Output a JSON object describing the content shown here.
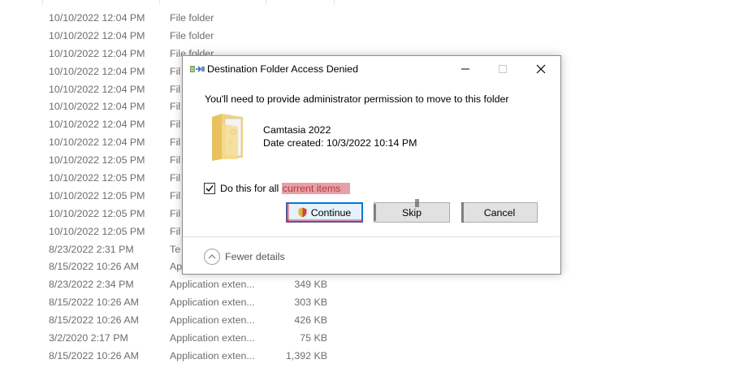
{
  "explorer": {
    "rows": [
      {
        "date": "10/10/2022 12:04 PM",
        "type": "File folder",
        "size": ""
      },
      {
        "date": "10/10/2022 12:04 PM",
        "type": "File folder",
        "size": ""
      },
      {
        "date": "10/10/2022 12:04 PM",
        "type": "File folder",
        "size": ""
      },
      {
        "date": "10/10/2022 12:04 PM",
        "type": "Fil",
        "size": ""
      },
      {
        "date": "10/10/2022 12:04 PM",
        "type": "Fil",
        "size": ""
      },
      {
        "date": "10/10/2022 12:04 PM",
        "type": "Fil",
        "size": ""
      },
      {
        "date": "10/10/2022 12:04 PM",
        "type": "Fil",
        "size": ""
      },
      {
        "date": "10/10/2022 12:04 PM",
        "type": "Fil",
        "size": ""
      },
      {
        "date": "10/10/2022 12:05 PM",
        "type": "Fil",
        "size": ""
      },
      {
        "date": "10/10/2022 12:05 PM",
        "type": "Fil",
        "size": ""
      },
      {
        "date": "10/10/2022 12:05 PM",
        "type": "Fil",
        "size": ""
      },
      {
        "date": "10/10/2022 12:05 PM",
        "type": "Fil",
        "size": ""
      },
      {
        "date": "10/10/2022 12:05 PM",
        "type": "Fil",
        "size": ""
      },
      {
        "date": "8/23/2022 2:31 PM",
        "type": "Te",
        "size": ""
      },
      {
        "date": "8/15/2022 10:26 AM",
        "type": "Ap",
        "size": ""
      },
      {
        "date": "8/23/2022 2:34 PM",
        "type": "Application exten...",
        "size": "349 KB"
      },
      {
        "date": "8/15/2022 10:26 AM",
        "type": "Application exten...",
        "size": "303 KB"
      },
      {
        "date": "8/15/2022 10:26 AM",
        "type": "Application exten...",
        "size": "426 KB"
      },
      {
        "date": "3/2/2020 2:17 PM",
        "type": "Application exten...",
        "size": "75 KB"
      },
      {
        "date": "8/15/2022 10:26 AM",
        "type": "Application exten...",
        "size": "1,392 KB"
      }
    ]
  },
  "dialog": {
    "title": "Destination Folder Access Denied",
    "message": "You'll need to provide administrator permission to move to this folder",
    "item": {
      "name": "Camtasia 2022",
      "date_created": "Date created: 10/3/2022 10:14 PM"
    },
    "checkbox": {
      "label_prefix": "Do this for all ",
      "label_highlight": "current items",
      "checked": true
    },
    "buttons": {
      "continue": "Continue",
      "skip": "Skip",
      "cancel": "Cancel"
    },
    "details_toggle": "Fewer details"
  },
  "colors": {
    "accent": "#0078d7",
    "highlight": "#e7a0a6",
    "folder": "#f3d27a"
  }
}
